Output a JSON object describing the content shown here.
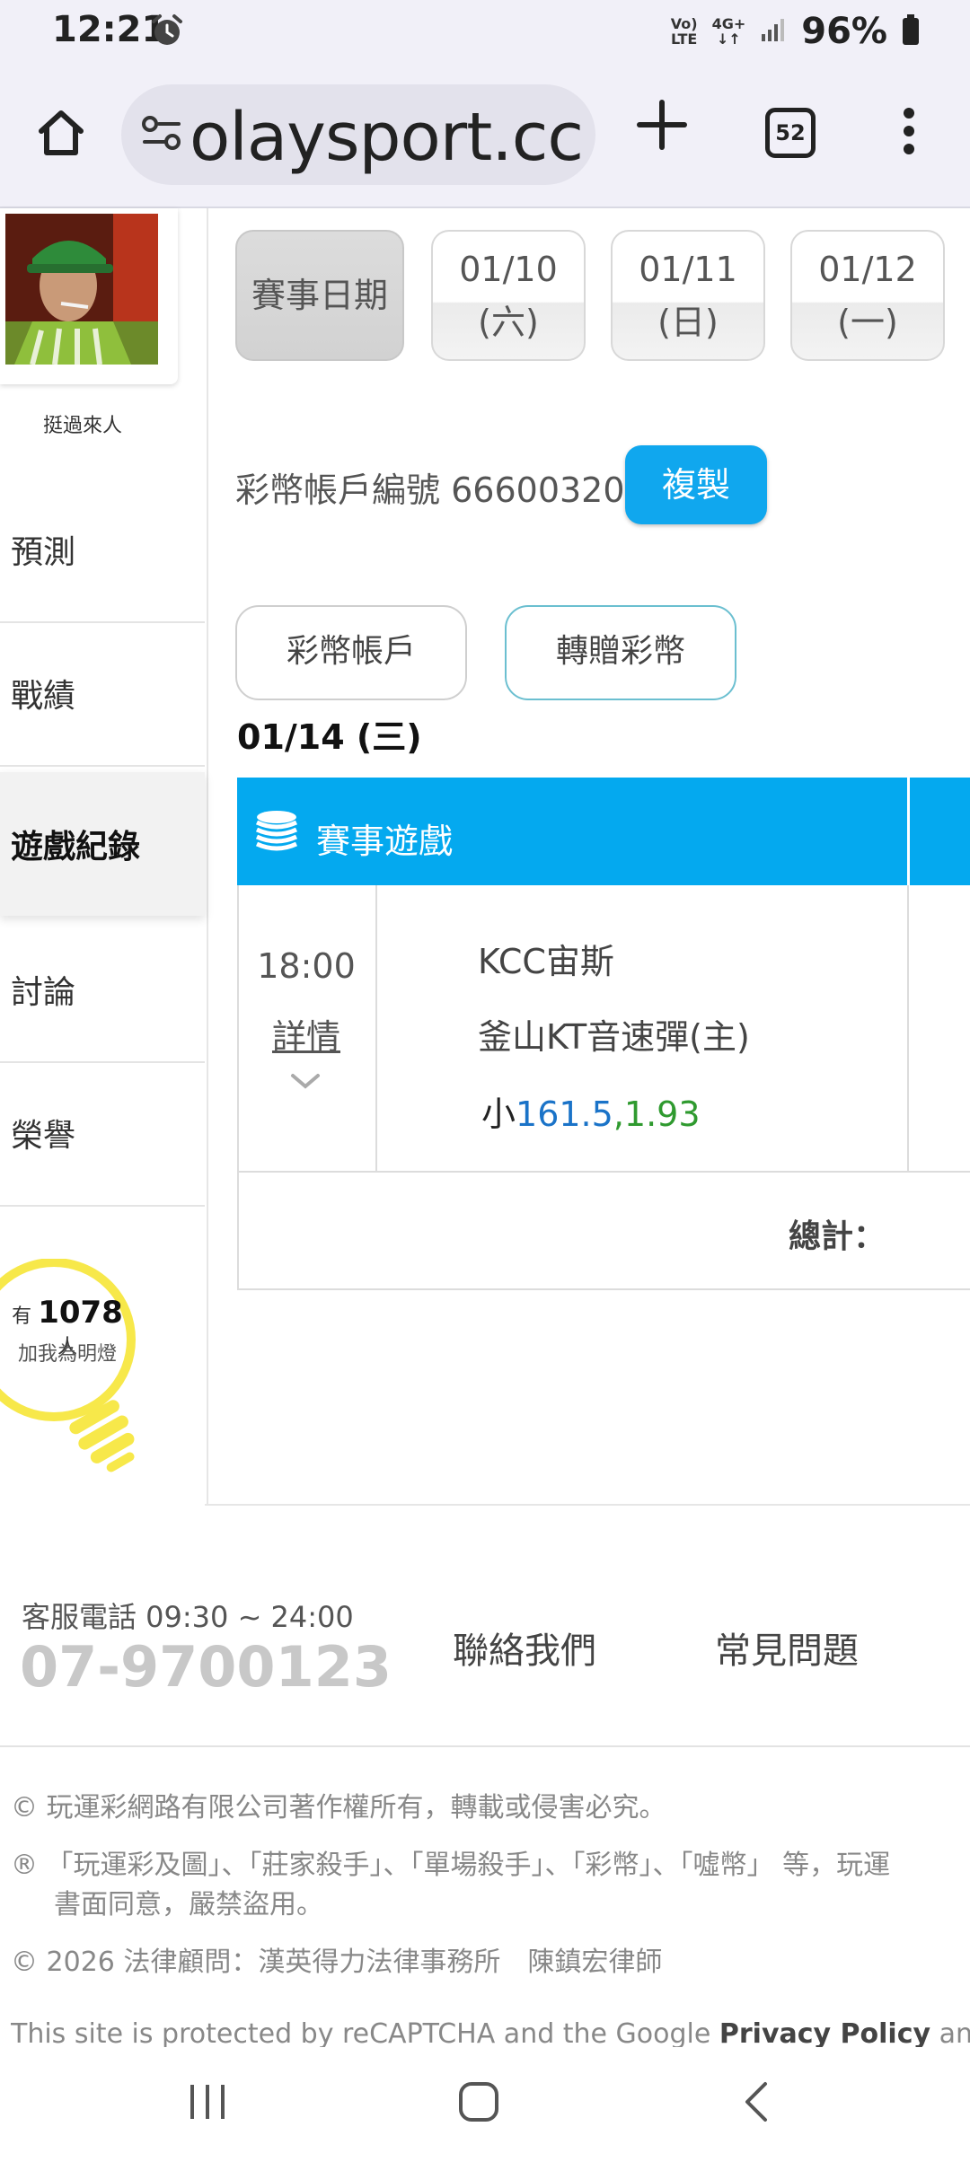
{
  "status_bar": {
    "time": "12:21",
    "volte": "Vo)\nLTE",
    "network": "4G+",
    "battery": "96%"
  },
  "browser": {
    "url": "olaysport.cc",
    "tab_count": "52"
  },
  "sidebar": {
    "username": "挺過來人",
    "items": [
      {
        "label": "預測"
      },
      {
        "label": "戰績"
      },
      {
        "label": "遊戲紀錄",
        "active": true
      },
      {
        "label": "討論"
      },
      {
        "label": "榮譽"
      }
    ],
    "fans": {
      "prefix": "有",
      "count": "1078",
      "suffix": "人",
      "sub": "加我為明燈"
    }
  },
  "date_filter": {
    "label": "賽事日期",
    "dates": [
      {
        "date": "01/10",
        "weekday": "(六)"
      },
      {
        "date": "01/11",
        "weekday": "(日)"
      },
      {
        "date": "01/12",
        "weekday": "(一)"
      }
    ]
  },
  "account": {
    "label": "彩幣帳戶編號",
    "number": "66600320",
    "copy_label": "複製",
    "buttons": [
      "彩幣帳戶",
      "轉贈彩幣"
    ]
  },
  "records": {
    "date_heading": "01/14 (三)",
    "header_label": "賽事遊戲",
    "rows": [
      {
        "time": "18:00",
        "detail_label": "詳情",
        "away_team": "KCC宙斯",
        "home_team": "釜山KT音速彈(主)",
        "pick": "小",
        "line": "161.5",
        "odds": ",1.93"
      }
    ],
    "total_label": "總計："
  },
  "footer": {
    "service_label": "客服電話 09:30 ~ 24:00",
    "phone": "07-9700123",
    "links": [
      "聯絡我們",
      "常見問題"
    ],
    "copyright": "© 玩運彩網路有限公司著作權所有，轉載或侵害必究。",
    "trademark_1": "® 「玩運彩及圖」、「莊家殺手」、「單場殺手」、「彩幣」、「噓幣」 等，玩運",
    "trademark_2": "書面同意，嚴禁盜用。",
    "legal_advisor": "© 2026 法律顧問：漢英得力法律事務所　陳鎮宏律師",
    "recaptcha_prefix": "This site is protected by reCAPTCHA and the Google ",
    "recaptcha_link": "Privacy Policy",
    "recaptcha_suffix": " and"
  },
  "icons": {
    "alarm": "alarm-icon",
    "home": "home-icon",
    "site_settings": "tune-icon",
    "new_tab": "plus-icon",
    "menu": "more-vert-icon",
    "coins": "coins-icon",
    "bulb": "lightbulb-icon"
  },
  "colors": {
    "accent": "#04a9ef",
    "copy_button": "#10a7ee",
    "line_value": "#1a73c8",
    "odds_value": "#2f9a2f"
  }
}
